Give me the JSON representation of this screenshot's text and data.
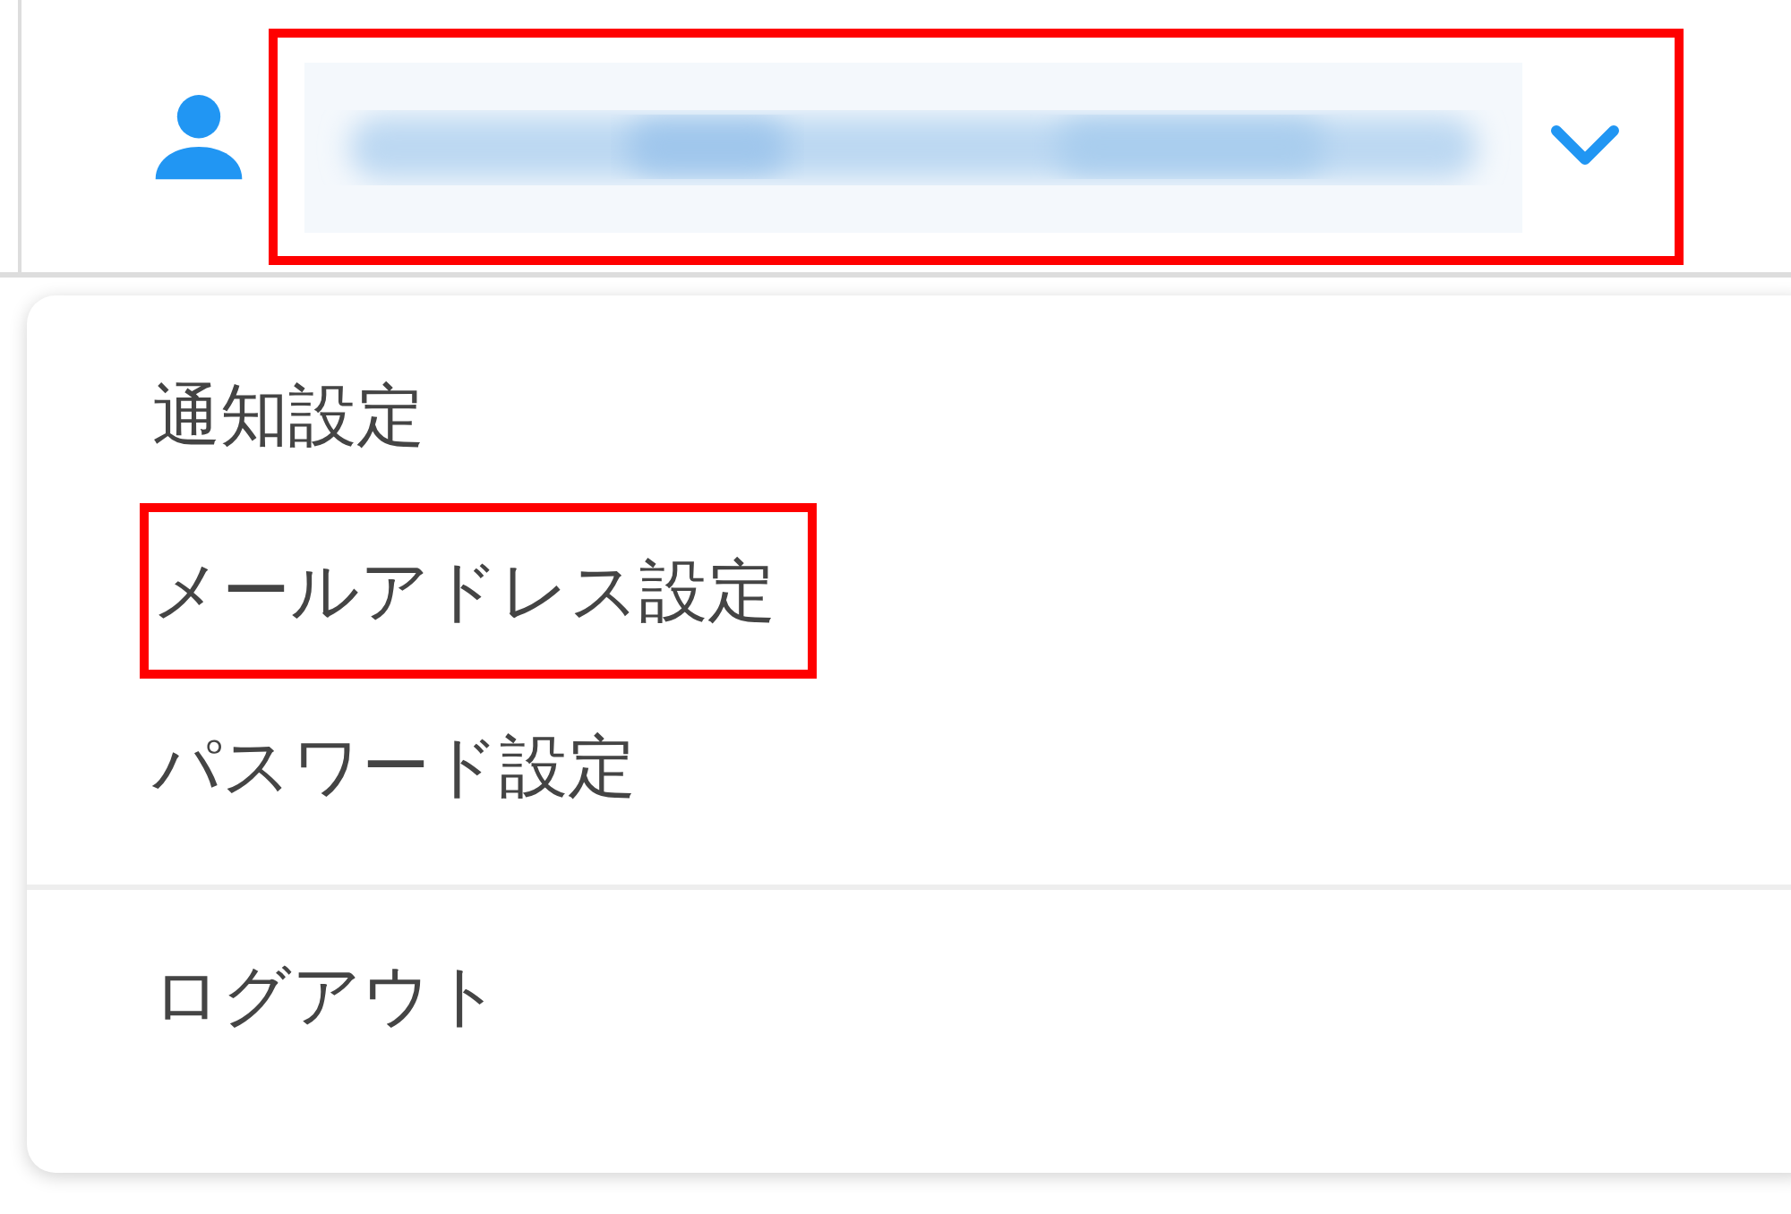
{
  "account_selector": {
    "highlighted": true
  },
  "menu": {
    "groups": [
      [
        {
          "label": "通知設定",
          "highlighted": false
        },
        {
          "label": "メールアドレス設定",
          "highlighted": true
        },
        {
          "label": "パスワード設定",
          "highlighted": false
        }
      ],
      [
        {
          "label": "ログアウト",
          "highlighted": false
        }
      ]
    ]
  }
}
